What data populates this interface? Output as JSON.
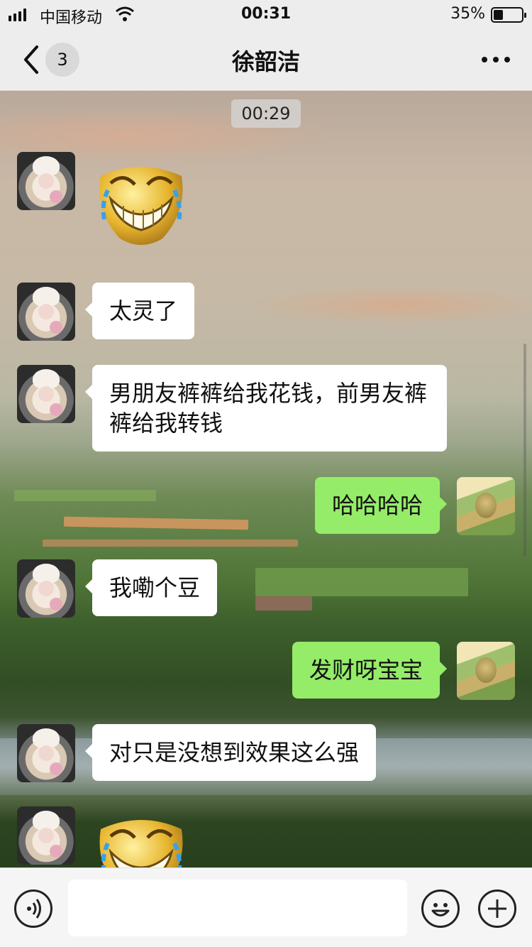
{
  "status_bar": {
    "carrier": "中国移动",
    "time": "00:31",
    "battery_percent": "35%",
    "battery_level": 0.35,
    "signal_bars": 4
  },
  "nav": {
    "back_badge": "3",
    "title": "徐韶洁",
    "more_icon": "more-icon"
  },
  "chat": {
    "timestamp": "00:29",
    "messages": [
      {
        "side": "left",
        "type": "sticker",
        "icon": "crying-laughing-sticker"
      },
      {
        "side": "left",
        "type": "text",
        "text": "太灵了"
      },
      {
        "side": "left",
        "type": "text",
        "text": "男朋友裤裤给我花钱，前男友裤裤给我转钱"
      },
      {
        "side": "right",
        "type": "text",
        "text": "哈哈哈哈"
      },
      {
        "side": "left",
        "type": "text",
        "text": "我嘞个豆"
      },
      {
        "side": "right",
        "type": "text",
        "text": "发财呀宝宝"
      },
      {
        "side": "left",
        "type": "text",
        "text": "对只是没想到效果这么强"
      },
      {
        "side": "left",
        "type": "sticker",
        "icon": "crying-laughing-sticker"
      }
    ]
  },
  "input_bar": {
    "voice_icon": "voice-icon",
    "emoji_icon": "emoji-icon",
    "plus_icon": "plus-icon"
  },
  "colors": {
    "bar_bg": "#ededed",
    "bubble_left": "#ffffff",
    "bubble_right": "#95ec69"
  }
}
